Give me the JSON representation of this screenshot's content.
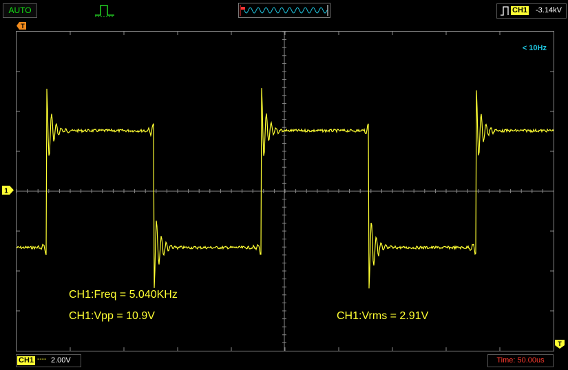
{
  "header": {
    "mode": "AUTO",
    "trigger_channel": "CH1",
    "trigger_level": "-3.14kV"
  },
  "screen": {
    "frequency_note": "< 10Hz",
    "measurements": {
      "freq": "CH1:Freq = 5.040KHz",
      "vpp": "CH1:Vpp = 10.9V",
      "vrms": "CH1:Vrms = 2.91V"
    },
    "markers": {
      "trigger_time": "T",
      "channel": "1",
      "trigger_end": "T"
    }
  },
  "footer": {
    "channel": "CH1",
    "coupling": "----",
    "volts_div": "2.00V",
    "timebase": "Time: 50.00us"
  },
  "colors": {
    "trace": "#ffff33",
    "grid": "#8a8a8a",
    "mode_text": "#14e014",
    "timebase_text": "#ff3b2f",
    "freq_note": "#1fc6e0",
    "marker": "#f08a1c"
  }
}
